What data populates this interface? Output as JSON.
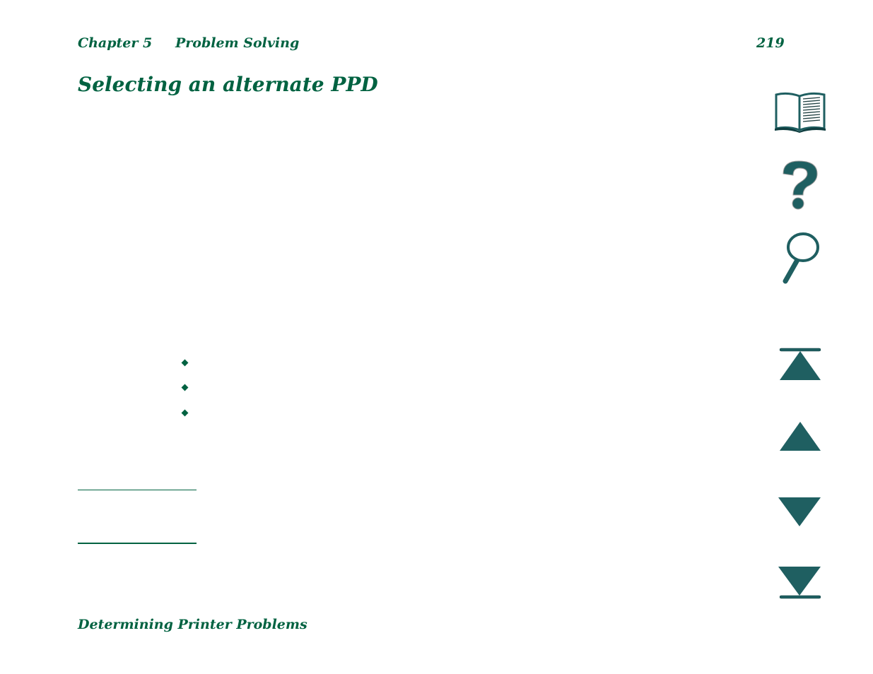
{
  "header": {
    "chapter": "Chapter 5",
    "section": "Problem Solving",
    "page_number": "219"
  },
  "page": {
    "title": "Selecting an alternate PPD",
    "bullets": [
      "",
      "",
      ""
    ]
  },
  "footer": {
    "text": "Determining Printer Problems"
  },
  "nav": {
    "icons": [
      "book-icon",
      "help-icon",
      "search-icon",
      "first-page-icon",
      "previous-page-icon",
      "next-page-icon",
      "last-page-icon"
    ]
  },
  "colors": {
    "text": "#006241",
    "icon": "#1f5f61",
    "icon_dark": "#0f3e40"
  }
}
